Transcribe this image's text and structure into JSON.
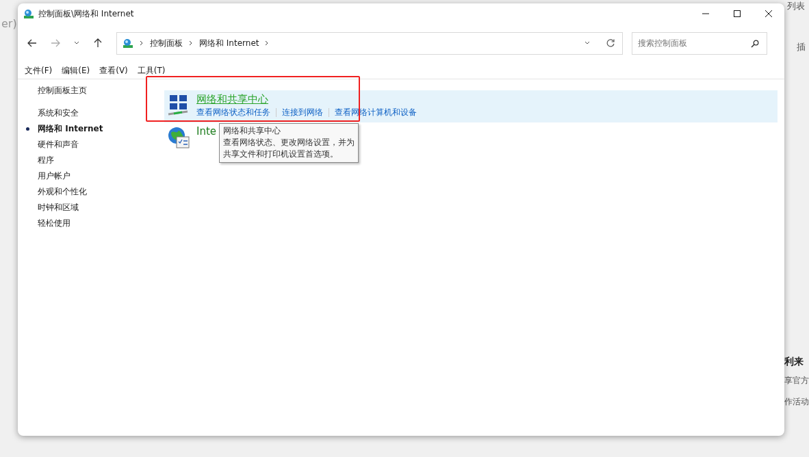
{
  "background_app": {
    "left_texts": [
      "er)"
    ],
    "right_texts": [
      "列表",
      "插",
      "利来",
      "享官方",
      "作活动"
    ]
  },
  "window": {
    "title": "控制面板\\网络和 Internet"
  },
  "address_bar": {
    "crumbs": [
      "控制面板",
      "网络和 Internet"
    ]
  },
  "search": {
    "placeholder": "搜索控制面板"
  },
  "menu": [
    "文件(F)",
    "编辑(E)",
    "查看(V)",
    "工具(T)"
  ],
  "sidebar": {
    "home": "控制面板主页",
    "items": [
      {
        "label": "系统和安全",
        "selected": false
      },
      {
        "label": "网络和 Internet",
        "selected": true
      },
      {
        "label": "硬件和声音",
        "selected": false
      },
      {
        "label": "程序",
        "selected": false
      },
      {
        "label": "用户帐户",
        "selected": false
      },
      {
        "label": "外观和个性化",
        "selected": false
      },
      {
        "label": "时钟和区域",
        "selected": false
      },
      {
        "label": "轻松使用",
        "selected": false
      }
    ]
  },
  "categories": [
    {
      "kind": "network",
      "title": "网络和共享中心",
      "hovered": true,
      "links": [
        "查看网络状态和任务",
        "连接到网络",
        "查看网络计算机和设备"
      ]
    },
    {
      "kind": "internet",
      "title": "Inte",
      "hovered": false
    }
  ],
  "tooltip": {
    "title": "网络和共享中心",
    "text": "查看网络状态、更改网络设置，并为共享文件和打印机设置首选项。"
  },
  "annotation": {
    "kind": "red-box"
  }
}
